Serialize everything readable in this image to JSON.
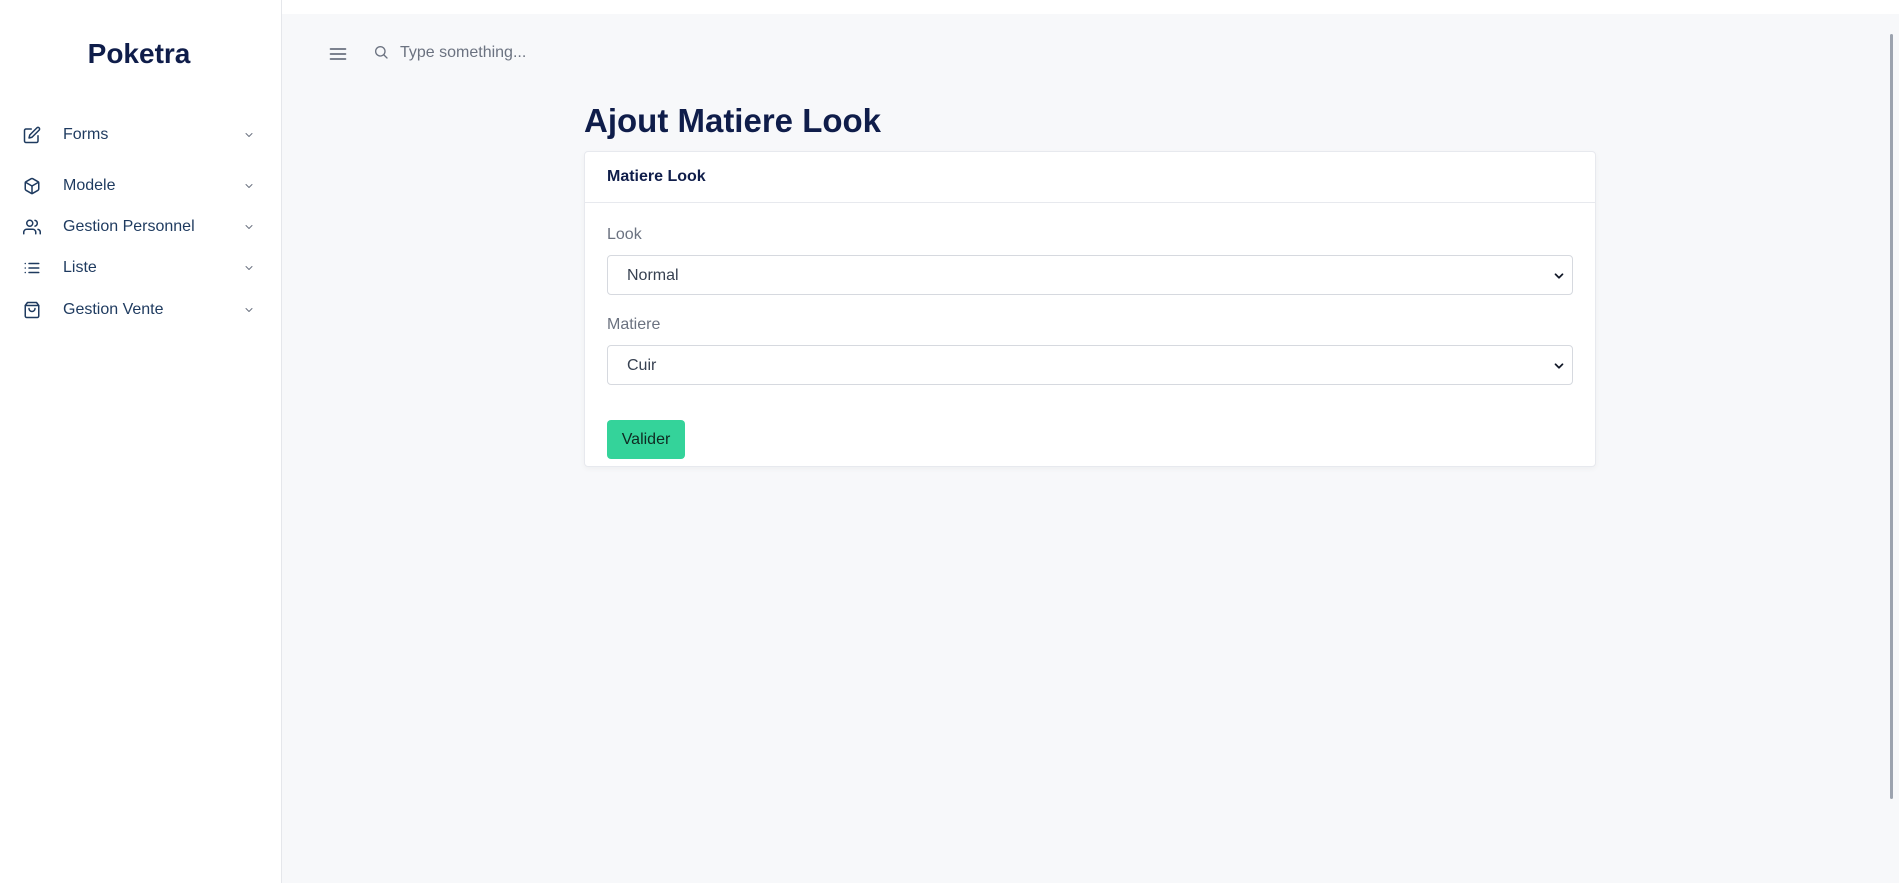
{
  "sidebar": {
    "brand": "Poketra",
    "items": [
      {
        "label": "Forms",
        "icon": "edit-icon"
      },
      {
        "label": "Modele",
        "icon": "cube-icon"
      },
      {
        "label": "Gestion Personnel",
        "icon": "users-icon"
      },
      {
        "label": "Liste",
        "icon": "list-icon"
      },
      {
        "label": "Gestion Vente",
        "icon": "shopping-bag-icon"
      }
    ]
  },
  "topbar": {
    "search_placeholder": "Type something..."
  },
  "page": {
    "title": "Ajout Matiere Look"
  },
  "card": {
    "title": "Matiere Look",
    "fields": [
      {
        "label": "Look",
        "selected": "Normal"
      },
      {
        "label": "Matiere",
        "selected": "Cuir"
      }
    ],
    "submit_label": "Valider"
  },
  "colors": {
    "brand_text": "#0f1d4a",
    "accent_button": "#34d39a",
    "main_background": "#f7f8fa"
  }
}
